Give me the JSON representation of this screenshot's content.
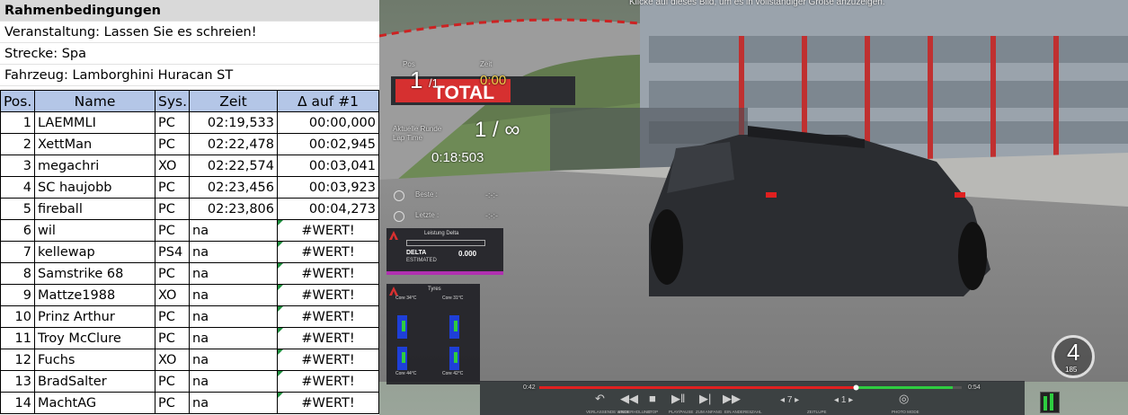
{
  "sheet": {
    "title": "Rahmenbedingungen",
    "event": "Veranstaltung: Lassen Sie es schreien!",
    "track": "Strecke: Spa",
    "car": "Fahrzeug: Lamborghini Huracan ST",
    "headers": [
      "Pos.",
      "Name",
      "Sys.",
      "Zeit",
      "Δ auf #1"
    ],
    "rows": [
      {
        "pos": "1",
        "name": "LAEMMLI",
        "sys": "PC",
        "time": "02:19,533",
        "delta": "00:00,000"
      },
      {
        "pos": "2",
        "name": "XettMan",
        "sys": "PC",
        "time": "02:22,478",
        "delta": "00:02,945"
      },
      {
        "pos": "3",
        "name": "megachri",
        "sys": "XO",
        "time": "02:22,574",
        "delta": "00:03,041"
      },
      {
        "pos": "4",
        "name": "SC haujobb",
        "sys": "PC",
        "time": "02:23,456",
        "delta": "00:03,923"
      },
      {
        "pos": "5",
        "name": "fireball",
        "sys": "PC",
        "time": "02:23,806",
        "delta": "00:04,273"
      },
      {
        "pos": "6",
        "name": "wil",
        "sys": "PC",
        "time": "na",
        "delta": "#WERT!"
      },
      {
        "pos": "7",
        "name": "kellewap",
        "sys": "PS4",
        "time": "na",
        "delta": "#WERT!"
      },
      {
        "pos": "8",
        "name": "Samstrike 68",
        "sys": "PC",
        "time": "na",
        "delta": "#WERT!"
      },
      {
        "pos": "9",
        "name": "Mattze1988",
        "sys": "XO",
        "time": "na",
        "delta": "#WERT!"
      },
      {
        "pos": "10",
        "name": "Prinz Arthur",
        "sys": "PC",
        "time": "na",
        "delta": "#WERT!"
      },
      {
        "pos": "11",
        "name": "Troy McClure",
        "sys": "PC",
        "time": "na",
        "delta": "#WERT!"
      },
      {
        "pos": "12",
        "name": "Fuchs",
        "sys": "XO",
        "time": "na",
        "delta": "#WERT!"
      },
      {
        "pos": "13",
        "name": "BradSalter",
        "sys": "PC",
        "time": "na",
        "delta": "#WERT!"
      },
      {
        "pos": "14",
        "name": "MachtAG",
        "sys": "PC",
        "time": "na",
        "delta": "#WERT!"
      }
    ]
  },
  "game": {
    "notice": "Klicke auf dieses Bild, um es in vollständiger Größe anzuzeigen.",
    "pos_label": "Pos",
    "pos_value": "1",
    "pos_total": "/1",
    "zeit_label": "Zeit",
    "zeit_value": "0:00",
    "lap_label_1": "Aktuelle Runde",
    "lap_label_2": "Lap Time",
    "lap_value": "1 / ∞",
    "lap_time": "0:18:503",
    "beste_label": "Beste :",
    "letzte_label": "Letzte :",
    "beste_value": "-:-:-",
    "letzte_value": "-:-:-",
    "banner": "TOTAL",
    "delta_widget": {
      "title": "Leistung Delta",
      "label": "DELTA",
      "sub": "ESTIMATED",
      "value": "0.000"
    },
    "tyre_widget": {
      "title": "Tyres",
      "core_fl": "Core 34°C",
      "core_fr": "Core 31°C",
      "core_rl": "Core 44°C",
      "core_rr": "Core 42°C"
    },
    "gear": "4",
    "speed": "185",
    "replay": {
      "time_left": "0:42",
      "time_right": "0:54",
      "progress": 0.75,
      "speed_value": "7",
      "cam_value": "1",
      "labels": [
        "VERLASSENDE WIEDERHOLUNG",
        "ENDE",
        "STOP",
        "PLAY/PAUSE",
        "ZUM ANFANG",
        "EIN ANDERES",
        "ZAHL",
        "ZEITLUPE",
        "PHOTO MODE"
      ]
    },
    "colors": {
      "time_yellow": "#f0d04b",
      "progress_red": "#e02020",
      "progress_green": "#2ecc40",
      "tyre_blue": "#1e3fd8",
      "header_blue": "#b4c6e7"
    }
  }
}
